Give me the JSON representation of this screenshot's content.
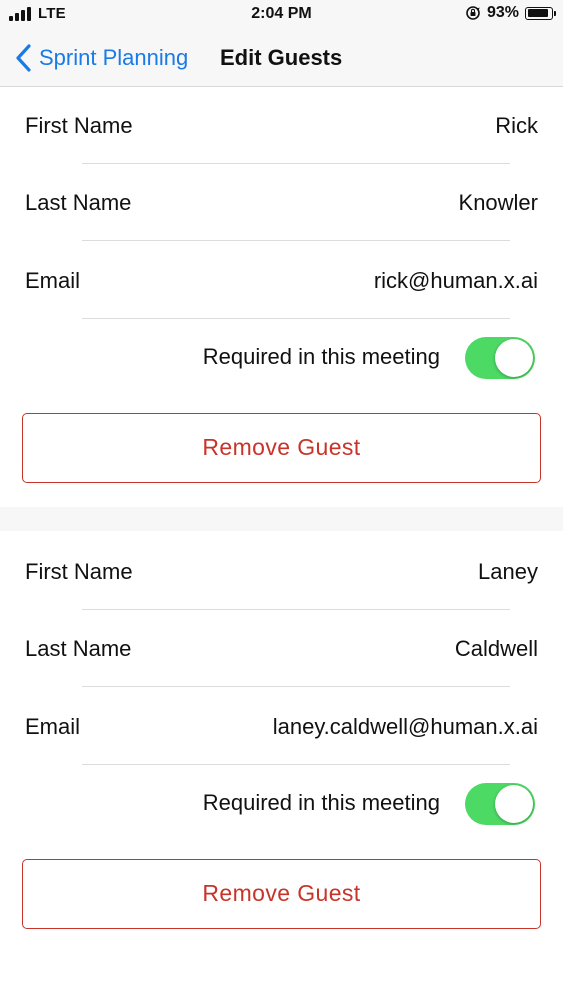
{
  "status_bar": {
    "carrier": "LTE",
    "time": "2:04 PM",
    "battery_percent": "93%",
    "battery_level": 0.93,
    "icons": [
      "signal-icon",
      "rotation-lock-icon",
      "battery-icon"
    ]
  },
  "nav": {
    "back_label": "Sprint Planning",
    "title": "Edit Guests",
    "back_icon": "chevron-left-icon",
    "accent_color": "#1a7ae6"
  },
  "labels": {
    "first_name": "First Name",
    "last_name": "Last Name",
    "email": "Email",
    "required": "Required in this meeting",
    "remove": "Remove Guest"
  },
  "colors": {
    "toggle_on": "#4cd964",
    "destructive": "#c8342a"
  },
  "guests": [
    {
      "first_name": "Rick",
      "last_name": "Knowler",
      "email": "rick@human.x.ai",
      "required": true
    },
    {
      "first_name": "Laney",
      "last_name": "Caldwell",
      "email": "laney.caldwell@human.x.ai",
      "required": true
    }
  ]
}
